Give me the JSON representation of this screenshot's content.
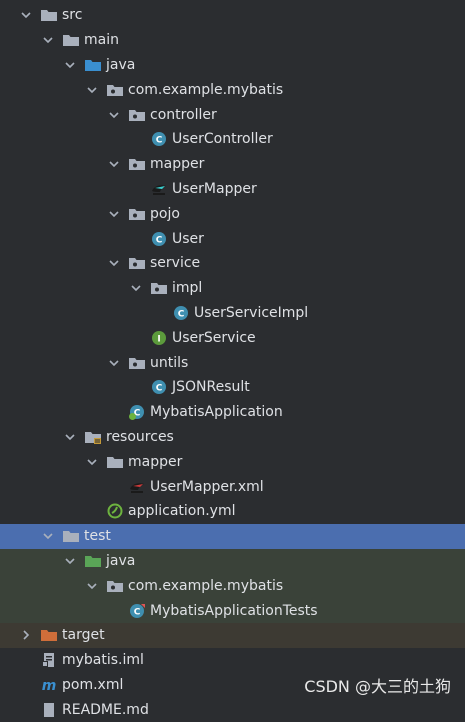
{
  "tree": [
    {
      "label": "src",
      "depth": 0,
      "expanded": true,
      "icon": "folder"
    },
    {
      "label": "main",
      "depth": 1,
      "expanded": true,
      "icon": "folder"
    },
    {
      "label": "java",
      "depth": 2,
      "expanded": true,
      "icon": "source-folder"
    },
    {
      "label": "com.example.mybatis",
      "depth": 3,
      "expanded": true,
      "icon": "package"
    },
    {
      "label": "controller",
      "depth": 4,
      "expanded": true,
      "icon": "package"
    },
    {
      "label": "UserController",
      "depth": 5,
      "leaf": true,
      "icon": "class"
    },
    {
      "label": "mapper",
      "depth": 4,
      "expanded": true,
      "icon": "package"
    },
    {
      "label": "UserMapper",
      "depth": 5,
      "leaf": true,
      "icon": "mybatis-mapper"
    },
    {
      "label": "pojo",
      "depth": 4,
      "expanded": true,
      "icon": "package"
    },
    {
      "label": "User",
      "depth": 5,
      "leaf": true,
      "icon": "class"
    },
    {
      "label": "service",
      "depth": 4,
      "expanded": true,
      "icon": "package"
    },
    {
      "label": "impl",
      "depth": 5,
      "expanded": true,
      "icon": "package"
    },
    {
      "label": "UserServiceImpl",
      "depth": 6,
      "leaf": true,
      "icon": "class"
    },
    {
      "label": "UserService",
      "depth": 5,
      "leaf": true,
      "icon": "interface"
    },
    {
      "label": "untils",
      "depth": 4,
      "expanded": true,
      "icon": "package"
    },
    {
      "label": "JSONResult",
      "depth": 5,
      "leaf": true,
      "icon": "class"
    },
    {
      "label": "MybatisApplication",
      "depth": 4,
      "leaf": true,
      "icon": "spring-boot-class"
    },
    {
      "label": "resources",
      "depth": 2,
      "expanded": true,
      "icon": "resources-folder"
    },
    {
      "label": "mapper",
      "depth": 3,
      "expanded": true,
      "icon": "folder"
    },
    {
      "label": "UserMapper.xml",
      "depth": 4,
      "leaf": true,
      "icon": "mybatis-xml"
    },
    {
      "label": "application.yml",
      "depth": 3,
      "leaf": true,
      "icon": "spring-yml"
    },
    {
      "label": "test",
      "depth": 1,
      "expanded": true,
      "icon": "folder",
      "state": "selected"
    },
    {
      "label": "java",
      "depth": 2,
      "expanded": true,
      "icon": "test-source-folder",
      "state": "testsrc"
    },
    {
      "label": "com.example.mybatis",
      "depth": 3,
      "expanded": true,
      "icon": "package",
      "state": "testsrc"
    },
    {
      "label": "MybatisApplicationTests",
      "depth": 4,
      "leaf": true,
      "icon": "test-class",
      "state": "testsrc"
    },
    {
      "label": "target",
      "depth": 0,
      "expanded": false,
      "icon": "excluded-folder",
      "state": "excluded"
    },
    {
      "label": "mybatis.iml",
      "depth": 0,
      "leaf": true,
      "icon": "iml-file"
    },
    {
      "label": "pom.xml",
      "depth": 0,
      "leaf": true,
      "icon": "maven-file"
    },
    {
      "label": "README.md",
      "depth": 0,
      "leaf": true,
      "icon": "markdown-file"
    }
  ],
  "watermark": "CSDN @大三的土狗",
  "colors": {
    "background": "#2b2d30",
    "selected": "#4b6eaf",
    "test": "#3a4239",
    "excluded": "#3d3a33",
    "folder": "#a9b0bc",
    "source": "#3a8fd0",
    "test_source": "#5aa557",
    "resources": "#a9b0bc",
    "class": "#3f8fb0",
    "interface": "#5c9b3c",
    "target": "#cf6e3a"
  }
}
